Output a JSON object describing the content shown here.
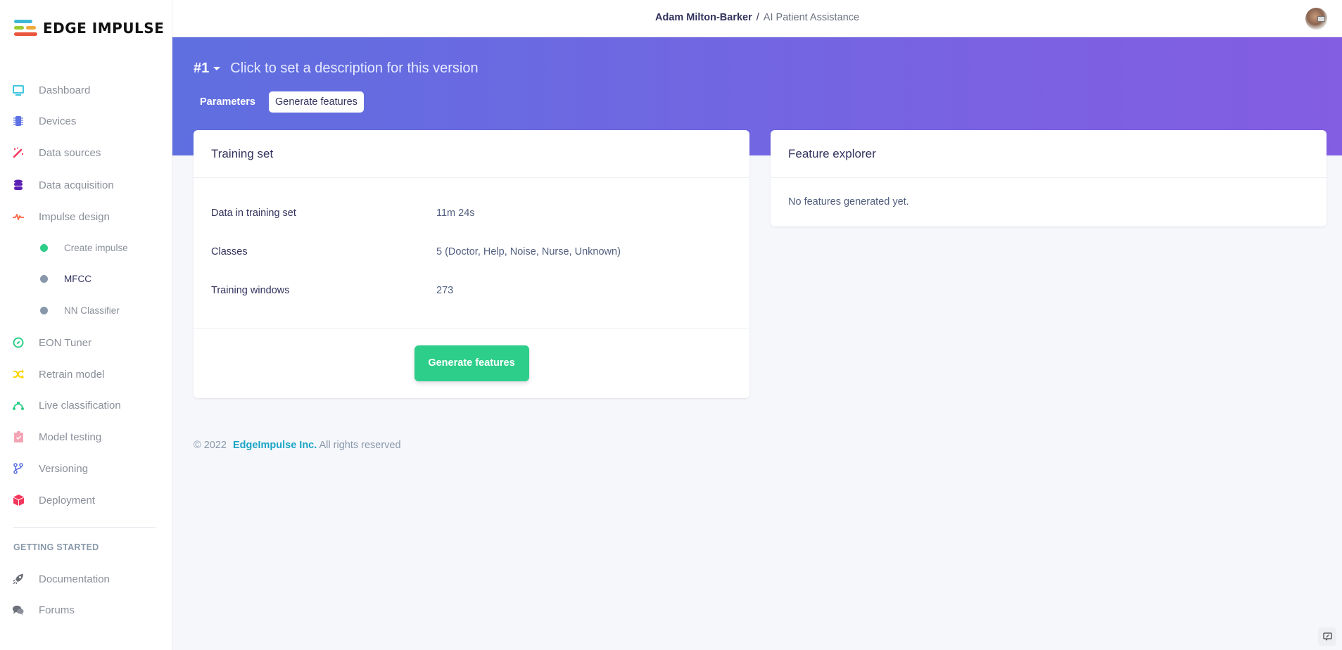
{
  "brand": {
    "name": "EDGE IMPULSE"
  },
  "colors": {
    "hero_gradient_start": "#5f6fe0",
    "hero_gradient_end": "#835de2",
    "primary_button": "#2dce89",
    "link": "#1aa5c5",
    "active_dot": "#2dce89",
    "inactive_dot": "#8898aa"
  },
  "sidebar": {
    "items": [
      {
        "label": "Dashboard",
        "icon": "monitor-icon"
      },
      {
        "label": "Devices",
        "icon": "chip-icon"
      },
      {
        "label": "Data sources",
        "icon": "magic-wand-icon"
      },
      {
        "label": "Data acquisition",
        "icon": "database-icon"
      },
      {
        "label": "Impulse design",
        "icon": "pulse-icon"
      },
      {
        "label": "EON Tuner",
        "icon": "compass-icon"
      },
      {
        "label": "Retrain model",
        "icon": "shuffle-icon"
      },
      {
        "label": "Live classification",
        "icon": "bezier-icon"
      },
      {
        "label": "Model testing",
        "icon": "clipboard-check-icon"
      },
      {
        "label": "Versioning",
        "icon": "code-branch-icon"
      },
      {
        "label": "Deployment",
        "icon": "cube-icon"
      }
    ],
    "sub_items": [
      {
        "label": "Create impulse",
        "status": "complete"
      },
      {
        "label": "MFCC",
        "status": "active"
      },
      {
        "label": "NN Classifier",
        "status": "pending"
      }
    ],
    "section_heading": "GETTING STARTED",
    "getting_started": [
      {
        "label": "Documentation",
        "icon": "rocket-icon"
      },
      {
        "label": "Forums",
        "icon": "comments-icon"
      }
    ]
  },
  "header": {
    "owner": "Adam Milton-Barker",
    "separator": "/",
    "project": "AI Patient Assistance"
  },
  "hero": {
    "version": "#1",
    "description": "Click to set a description for this version",
    "tabs": [
      {
        "label": "Parameters",
        "active": false
      },
      {
        "label": "Generate features",
        "active": true
      }
    ]
  },
  "training_card": {
    "title": "Training set",
    "rows": [
      {
        "key": "Data in training set",
        "value": "11m 24s"
      },
      {
        "key": "Classes",
        "value": "5 (Doctor, Help, Noise, Nurse, Unknown)"
      },
      {
        "key": "Training windows",
        "value": "273"
      }
    ],
    "button_label": "Generate features"
  },
  "feature_card": {
    "title": "Feature explorer",
    "empty_text": "No features generated yet."
  },
  "footer": {
    "copyright": "© 2022",
    "company": "EdgeImpulse Inc.",
    "rights": "All rights reserved"
  }
}
